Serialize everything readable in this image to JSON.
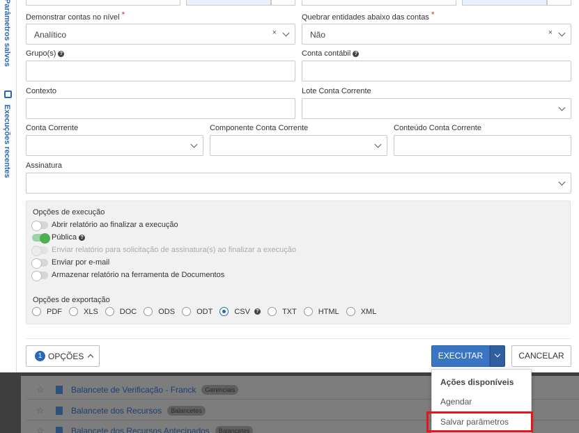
{
  "sidebar": {
    "saved_params": "Parâmetros salvos",
    "recent_runs": "Execuções recentes"
  },
  "form": {
    "nivel": {
      "label": "Demonstrar contas no nível",
      "required_mark": "*",
      "value": "Analítico"
    },
    "quebrar": {
      "label": "Quebrar entidades abaixo das contas",
      "required_mark": "*",
      "value": "Não"
    },
    "grupos": {
      "label": "Grupo(s)",
      "help": "?"
    },
    "conta_contabil": {
      "label": "Conta contábil",
      "help": "?"
    },
    "contexto": {
      "label": "Contexto"
    },
    "lote": {
      "label": "Lote Conta Corrente"
    },
    "conta_corrente": {
      "label": "Conta Corrente"
    },
    "componente": {
      "label": "Componente Conta Corrente"
    },
    "conteudo": {
      "label": "Conteúdo Conta Corrente"
    },
    "assinatura": {
      "label": "Assinatura"
    },
    "clear_glyph": "×"
  },
  "execution_options": {
    "title": "Opções de execução",
    "toggles": [
      {
        "label": "Abrir relatório ao finalizar a execução",
        "state": "off"
      },
      {
        "label": "Pública",
        "state": "on",
        "help": "?"
      },
      {
        "label": "Enviar relatório para solicitação de assinatura(s) ao finalizar a execução",
        "state": "disabled"
      },
      {
        "label": "Enviar por e-mail",
        "state": "off"
      },
      {
        "label": "Armazenar relatório na ferramenta de Documentos",
        "state": "off"
      }
    ]
  },
  "export_options": {
    "title": "Opções de exportação",
    "formats": [
      "PDF",
      "XLS",
      "DOC",
      "ODS",
      "ODT",
      "CSV",
      "TXT",
      "HTML",
      "XML"
    ],
    "selected": "CSV",
    "help": "?"
  },
  "footer": {
    "options_count": "1",
    "options_label": "OPÇÕES",
    "execute_label": "EXECUTAR",
    "cancel_label": "CANCELAR"
  },
  "actions_menu": {
    "header": "Ações disponíveis",
    "items": [
      "Agendar",
      "Salvar parâmetros"
    ]
  },
  "background_list": [
    {
      "title": "Balancete de Verificação - Franck",
      "tag": "Gerenciais"
    },
    {
      "title": "Balancete dos Recursos",
      "tag": "Balancetes"
    },
    {
      "title": "Balancete dos Recursos Antecipados",
      "tag": "Balancetes"
    }
  ],
  "colors": {
    "primary": "#3a75c4",
    "required": "#d9302c",
    "highlight": "#e8141a",
    "toggle_on": "#4caf50"
  }
}
